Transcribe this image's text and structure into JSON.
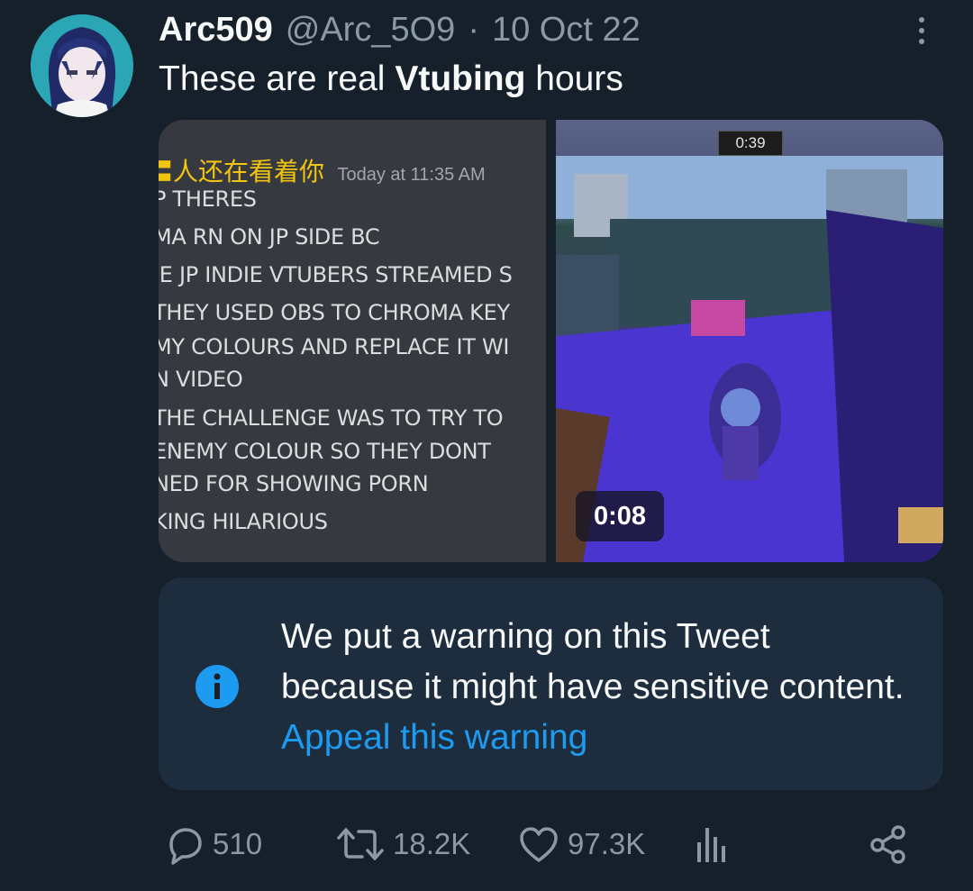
{
  "tweet": {
    "author_name": "Arc509",
    "handle": "@Arc_5O9",
    "separator": "·",
    "date": "10 Oct 22",
    "text_before": "These are real ",
    "text_bold": "Vtubing",
    "text_after": " hours"
  },
  "media": {
    "screenshot": {
      "username": "〓人还在看着你",
      "timestamp": "Today at 11:35 AM",
      "lines": [
        "P THERES",
        "MA RN ON JP SIDE BC",
        "IE JP INDIE VTUBERS STREAMED S",
        "THEY USED OBS TO CHROMA KEY",
        "MY COLOURS AND REPLACE IT WI",
        "N VIDEO",
        "THE CHALLENGE WAS TO TRY TO",
        "ENEMY COLOUR SO THEY DONT",
        "NED FOR SHOWING PORN",
        "KING HILARIOUS"
      ]
    },
    "video": {
      "game_timer": "0:39",
      "duration": "0:08"
    }
  },
  "warning": {
    "text": "We put a warning on this Tweet because it might have sensitive content. ",
    "link": "Appeal this warning"
  },
  "actions": {
    "replies": "510",
    "retweets": "18.2K",
    "likes": "97.3K"
  },
  "icons": {
    "info": "info-icon",
    "reply": "reply-icon",
    "retweet": "retweet-icon",
    "like": "heart-icon",
    "views": "analytics-icon",
    "share": "share-icon",
    "more": "more-icon"
  },
  "colors": {
    "background": "#15202b",
    "accent": "#1d9bf0",
    "warning_box": "#1e2d3d",
    "muted_text": "#8b98a5"
  }
}
